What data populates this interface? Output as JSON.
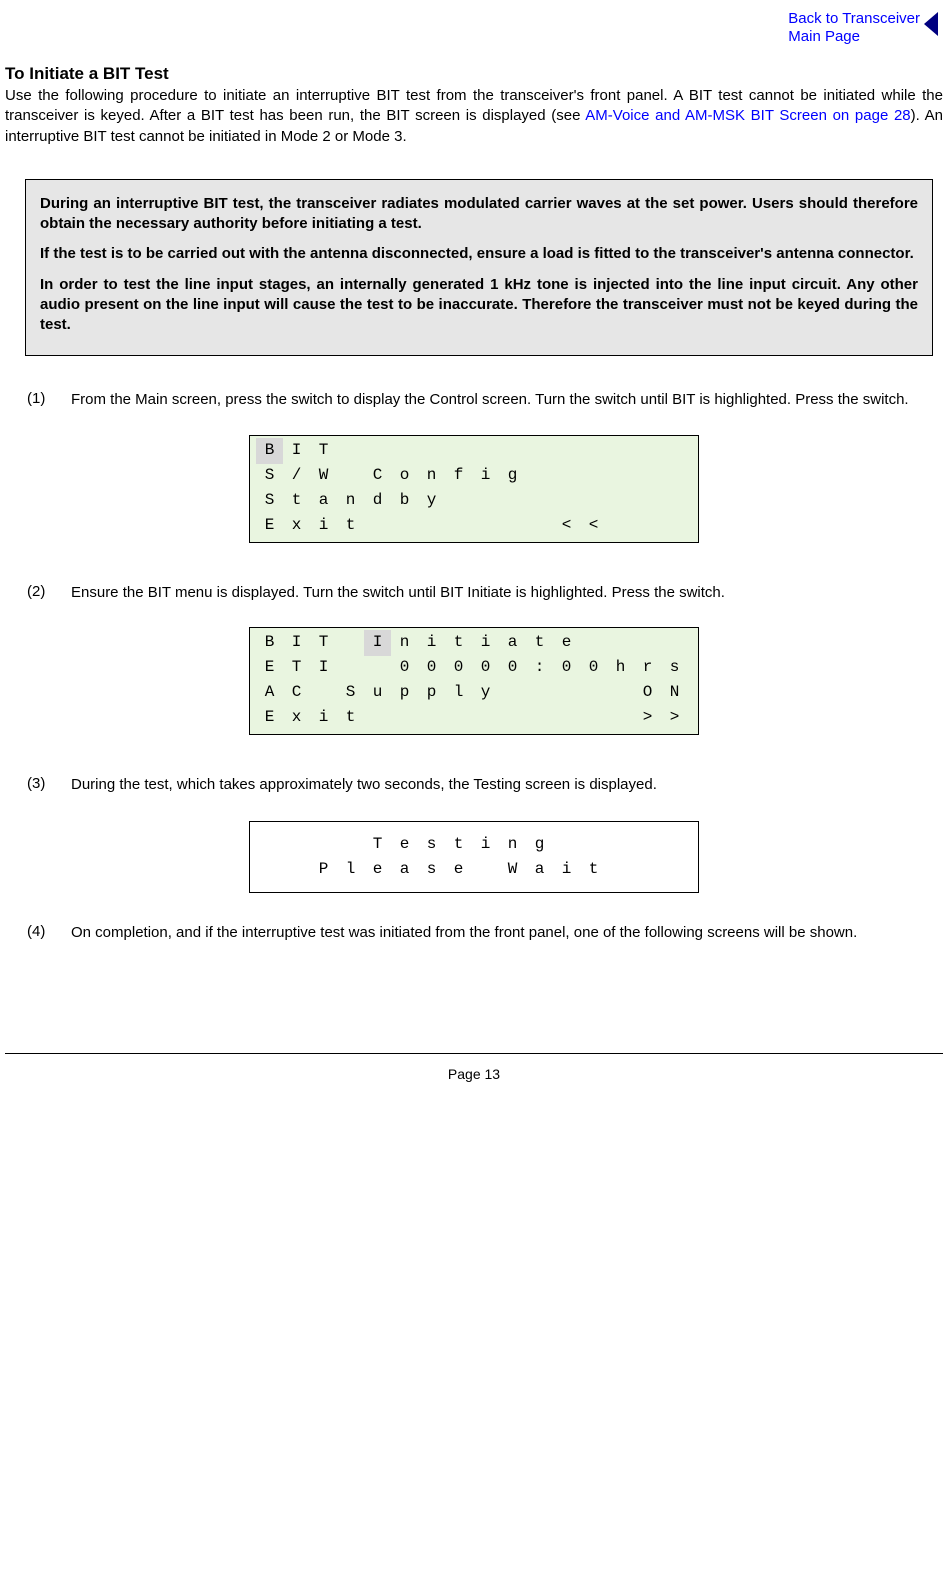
{
  "header": {
    "back_link_line1": "Back to Transceiver",
    "back_link_line2": "Main Page"
  },
  "title": "To Initiate a BIT Test",
  "intro_part1": "Use the following procedure to initiate an interruptive BIT test from the transceiver's front panel. A BIT test cannot be initiated while the transceiver is keyed. After a BIT test has been run, the BIT screen is displayed (see ",
  "intro_link": "AM-Voice and AM-MSK BIT Screen on page 28",
  "intro_part2": "). An interruptive BIT test cannot be initiated in Mode 2 or Mode 3.",
  "note": {
    "p1": "During an interruptive BIT test, the transceiver radiates modulated carrier waves at the set power. Users should therefore obtain the necessary authority before initiating a test.",
    "p2": "If the test is to be carried out with the antenna disconnected, ensure a load is fitted to the transceiver's antenna connector.",
    "p3": "In order to test the line input stages, an internally generated 1 kHz tone is injected into the line input circuit. Any other audio present on the line input will cause the test to be inaccurate. Therefore the transceiver must not be keyed during the test."
  },
  "steps": {
    "s1_num": "(1)",
    "s1_text": "From the Main screen, press the switch to display the Control screen. Turn the switch until BIT is highlighted. Press the switch.",
    "s2_num": "(2)",
    "s2_text": "Ensure the BIT menu is displayed. Turn the switch until BIT Initiate is highlighted. Press the switch.",
    "s3_num": "(3)",
    "s3_text": "During the test, which takes approximately two seconds, the Testing screen is displayed.",
    "s4_num": "(4)",
    "s4_text": "On completion, and if the interruptive test was initiated from the front panel, one of the following screens will be shown."
  },
  "lcd1": {
    "rows": [
      [
        "B",
        "I",
        "T",
        "",
        "",
        "",
        "",
        "",
        "",
        "",
        "",
        "",
        "",
        "",
        "",
        ""
      ],
      [
        "S",
        "/",
        "W",
        "",
        "C",
        "o",
        "n",
        "f",
        "i",
        "g",
        "",
        "",
        "",
        "",
        "",
        ""
      ],
      [
        "S",
        "t",
        "a",
        "n",
        "d",
        "b",
        "y",
        "",
        "",
        "",
        "",
        "",
        "",
        "",
        "",
        ""
      ],
      [
        "E",
        "x",
        "i",
        "t",
        "",
        "",
        "",
        "",
        "",
        "",
        "",
        "<",
        "<",
        "",
        "",
        ""
      ]
    ],
    "highlight": {
      "row": 0,
      "col": 0
    }
  },
  "lcd2": {
    "rows": [
      [
        "B",
        "I",
        "T",
        "",
        "I",
        "n",
        "i",
        "t",
        "i",
        "a",
        "t",
        "e",
        "",
        "",
        "",
        ""
      ],
      [
        "E",
        "T",
        "I",
        "",
        "",
        "0",
        "0",
        "0",
        "0",
        "0",
        ":",
        "0",
        "0",
        "h",
        "r",
        "s"
      ],
      [
        "A",
        "C",
        "",
        "S",
        "u",
        "p",
        "p",
        "l",
        "y",
        "",
        "",
        "",
        "",
        "",
        "O",
        "N"
      ],
      [
        "E",
        "x",
        "i",
        "t",
        "",
        "",
        "",
        "",
        "",
        "",
        "",
        "",
        "",
        "",
        ">",
        ">"
      ]
    ],
    "highlight": {
      "row": 0,
      "col": 4
    }
  },
  "lcd3": {
    "rows": [
      [
        "",
        "",
        "",
        "",
        "T",
        "e",
        "s",
        "t",
        "i",
        "n",
        "g",
        "",
        "",
        "",
        "",
        ""
      ],
      [
        "",
        "",
        "P",
        "l",
        "e",
        "a",
        "s",
        "e",
        "",
        "W",
        "a",
        "i",
        "t",
        "",
        "",
        ""
      ]
    ]
  },
  "footer": "Page 13"
}
